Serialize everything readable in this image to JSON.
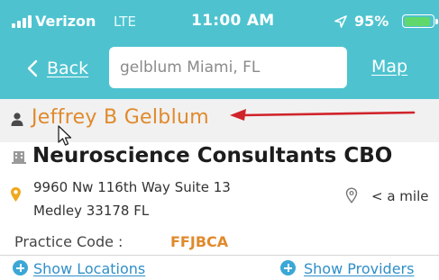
{
  "status_bar": {
    "carrier": "Verizon",
    "network": "LTE",
    "time": "11:00 AM",
    "battery_percent_label": "95%",
    "battery_level": 0.95,
    "icons": [
      "signal-bars-icon",
      "location-arrow-icon",
      "battery-icon"
    ]
  },
  "nav": {
    "back_label": "Back",
    "search_value": "gelblum Miami, FL",
    "map_label": "Map"
  },
  "provider": {
    "name": "Jeffrey B Gelblum"
  },
  "practice": {
    "name": "Neuroscience Consultants CBO",
    "address_line1": "9960 Nw 116th Way Suite 13",
    "address_line2": "Medley 33178 FL",
    "distance": "< a mile",
    "code_label": "Practice Code :",
    "code_value": "FFJBCA"
  },
  "actions": {
    "show_locations": "Show Locations",
    "show_providers": "Show Providers"
  },
  "colors": {
    "header_bg": "#4ec3cf",
    "accent_orange": "#e08a2c",
    "link_blue": "#2f8fc8",
    "annotation_red": "#d0232a"
  }
}
